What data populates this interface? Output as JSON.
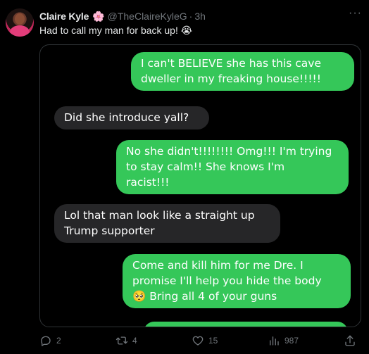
{
  "tweet": {
    "display_name": "Claire Kyle",
    "name_emoji": "🌸",
    "handle": "@TheClaireKyleG",
    "separator": "·",
    "time": "3h",
    "text": "Had to call my man for back up!",
    "text_emoji": "😭",
    "more_label": "···"
  },
  "messages": [
    {
      "side": "sent",
      "lines": [
        "I can't BELIEVE she has this cave",
        "dweller in my freaking house!!!!!"
      ]
    },
    {
      "side": "received",
      "lines": [
        "Did she introduce yall?"
      ]
    },
    {
      "side": "sent",
      "lines": [
        "No she didn't!!!!!!!! Omg!!! I'm trying",
        "to stay calm!! She knows I'm",
        "racist!!!"
      ]
    },
    {
      "side": "received",
      "lines": [
        "Lol that man look like a straight up",
        "Trump supporter"
      ]
    },
    {
      "side": "sent",
      "lines": [
        "Come and kill him for me Dre. I",
        "promise I'll help you hide the body",
        "🥺 Bring all 4 of your guns"
      ]
    }
  ],
  "actions": {
    "replies": "2",
    "retweets": "4",
    "likes": "15",
    "views": "987"
  },
  "colors": {
    "sent_bubble": "#35c759",
    "received_bubble": "#262628",
    "muted_text": "#71767b"
  },
  "icons": [
    "reply-icon",
    "retweet-icon",
    "like-icon",
    "views-icon",
    "share-icon",
    "more-icon"
  ]
}
